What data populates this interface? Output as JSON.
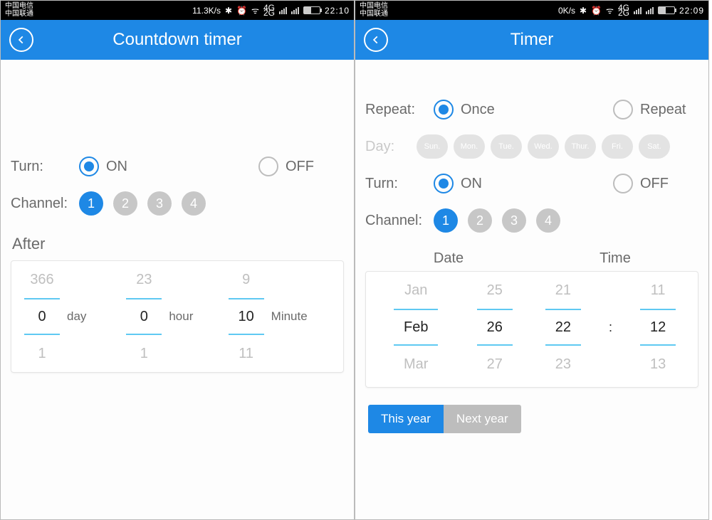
{
  "left": {
    "status": {
      "carrier1": "中国电信",
      "carrier2": "中国联通",
      "speed": "11.3K/s",
      "clock": "22:10",
      "net_top": "4G",
      "net_bot": "2G"
    },
    "title": "Countdown timer",
    "turn": {
      "label": "Turn:",
      "on": "ON",
      "off": "OFF",
      "selected": "on"
    },
    "channel": {
      "label": "Channel:",
      "options": [
        "1",
        "2",
        "3",
        "4"
      ],
      "selected": "1"
    },
    "after_label": "After",
    "spinner": {
      "day": {
        "prev": "366",
        "cur": "0",
        "next": "1",
        "unit": "day"
      },
      "hour": {
        "prev": "23",
        "cur": "0",
        "next": "1",
        "unit": "hour"
      },
      "minute": {
        "prev": "9",
        "cur": "10",
        "next": "11",
        "unit": "Minute"
      }
    }
  },
  "right": {
    "status": {
      "carrier1": "中国电信",
      "carrier2": "中国联通",
      "speed": "0K/s",
      "clock": "22:09",
      "net_top": "4G",
      "net_bot": "2G"
    },
    "title": "Timer",
    "repeat": {
      "label": "Repeat:",
      "once": "Once",
      "repeat": "Repeat",
      "selected": "once"
    },
    "day": {
      "label": "Day:",
      "options": [
        "Sun.",
        "Mon.",
        "Tue.",
        "Wed.",
        "Thur.",
        "Fri.",
        "Sat."
      ]
    },
    "turn": {
      "label": "Turn:",
      "on": "ON",
      "off": "OFF",
      "selected": "on"
    },
    "channel": {
      "label": "Channel:",
      "options": [
        "1",
        "2",
        "3",
        "4"
      ],
      "selected": "1"
    },
    "dt": {
      "date_label": "Date",
      "time_label": "Time",
      "month": {
        "prev": "Jan",
        "cur": "Feb",
        "next": "Mar"
      },
      "dayn": {
        "prev": "25",
        "cur": "26",
        "next": "27"
      },
      "hour": {
        "prev": "21",
        "cur": "22",
        "next": "23"
      },
      "minute": {
        "prev": "11",
        "cur": "12",
        "next": "13"
      },
      "sep": ":"
    },
    "year": {
      "this": "This year",
      "next": "Next year"
    }
  }
}
